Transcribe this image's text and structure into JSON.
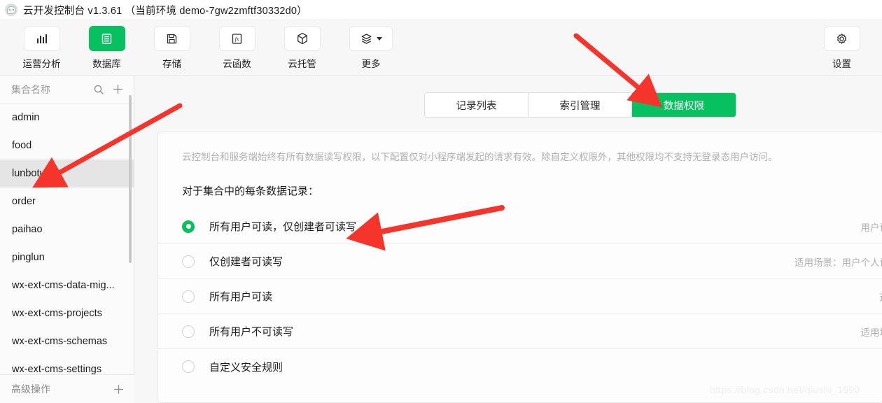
{
  "titlebar": {
    "icon": "wechat-bubble-icon",
    "title": "云开发控制台 v1.3.61 （当前环境 demo-7gw2zmftf30332d0）"
  },
  "toolbar": {
    "items": [
      {
        "label": "运营分析",
        "icon": "bar-chart-icon",
        "active": false
      },
      {
        "label": "数据库",
        "icon": "database-icon",
        "active": true
      },
      {
        "label": "存储",
        "icon": "save-floppy-icon",
        "active": false
      },
      {
        "label": "云函数",
        "icon": "fx-function-icon",
        "active": false
      },
      {
        "label": "云托管",
        "icon": "cube-icon",
        "active": false
      },
      {
        "label": "更多",
        "icon": "layers-icon",
        "active": false,
        "caret": true
      }
    ],
    "settings": {
      "label": "设置",
      "icon": "gear-icon"
    }
  },
  "sidebar": {
    "header": {
      "title": "集合名称",
      "search_icon": "search-icon",
      "add_icon": "plus-icon"
    },
    "collections": [
      {
        "name": "admin",
        "selected": false
      },
      {
        "name": "food",
        "selected": false
      },
      {
        "name": "lunbotu",
        "selected": true
      },
      {
        "name": "order",
        "selected": false
      },
      {
        "name": "paihao",
        "selected": false
      },
      {
        "name": "pinglun",
        "selected": false
      },
      {
        "name": "wx-ext-cms-data-mig...",
        "selected": false
      },
      {
        "name": "wx-ext-cms-projects",
        "selected": false
      },
      {
        "name": "wx-ext-cms-schemas",
        "selected": false
      },
      {
        "name": "wx-ext-cms-settings",
        "selected": false
      }
    ],
    "footer": {
      "label": "高级操作",
      "add_icon": "plus-icon"
    }
  },
  "main": {
    "tabs": [
      {
        "label": "记录列表",
        "active": false
      },
      {
        "label": "索引管理",
        "active": false
      },
      {
        "label": "数据权限",
        "active": true
      }
    ],
    "panel": {
      "description": "云控制台和服务端始终有所有数据读写权限，以下配置仅对小程序端发起的请求有效。除自定义权限外，其他权限均不支持无登录态用户访问。",
      "subtitle": "对于集合中的每条数据记录：",
      "options": [
        {
          "label": "所有用户可读，仅创建者可读写",
          "selected": true,
          "hint": "用户设"
        },
        {
          "label": "仅创建者可读写",
          "selected": false,
          "hint": "适用场景：用户个人设"
        },
        {
          "label": "所有用户可读",
          "selected": false,
          "hint": "适"
        },
        {
          "label": "所有用户不可读写",
          "selected": false,
          "hint": "适用场"
        },
        {
          "label": "自定义安全规则",
          "selected": false,
          "hint": ""
        }
      ]
    }
  },
  "annotations": {
    "arrows": [
      {
        "name": "arrow-to-data-permission-tab",
        "color": "#f5352b"
      },
      {
        "name": "arrow-to-lunbotu-collection",
        "color": "#f5352b"
      },
      {
        "name": "arrow-to-selected-option",
        "color": "#f5352b"
      }
    ],
    "watermark": "https://blog.csdn.net/qiushi_1990"
  },
  "colors": {
    "accent_green": "#07c160",
    "arrow_red": "#f5352b",
    "selected_row": "#e5e5e5"
  }
}
